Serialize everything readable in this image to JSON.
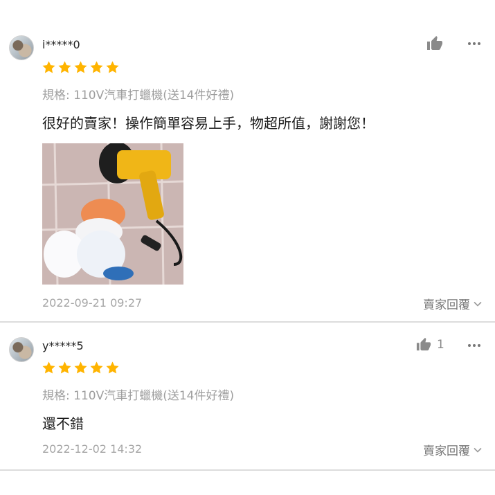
{
  "reviews": [
    {
      "username": "i*****0",
      "rating": 5,
      "variant": "規格: 110V汽車打蠟機(送14件好禮)",
      "comment": "很好的賣家！操作簡單容易上手，物超所值，謝謝您！",
      "has_photo": true,
      "date": "2022-09-21 09:27",
      "like_count": "",
      "reply_label": "賣家回覆"
    },
    {
      "username": "y*****5",
      "rating": 5,
      "variant": "規格: 110V汽車打蠟機(送14件好禮)",
      "comment": "還不錯",
      "has_photo": false,
      "date": "2022-12-02 14:32",
      "like_count": "1",
      "reply_label": "賣家回覆"
    }
  ],
  "colors": {
    "star": "#FFB400",
    "muted_text": "#A6A6A6",
    "icon": "#8A8A8A",
    "divider": "#DCDCDC"
  }
}
